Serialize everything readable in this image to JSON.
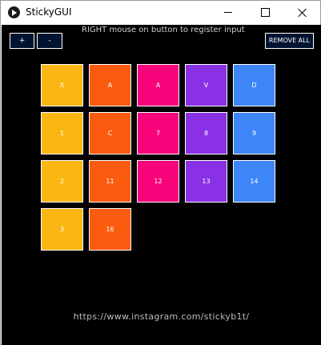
{
  "window": {
    "title": "StickyGUI",
    "icon": "play-icon",
    "controls": [
      "minimize-icon",
      "maximize-icon",
      "close-icon"
    ]
  },
  "toolbar": {
    "add_label": "+",
    "remove_label": "-",
    "remove_all_label": "REMOVE ALL",
    "hint": "RIGHT mouse on button to register input"
  },
  "colors": {
    "background": "#000000",
    "button_bg": "#001432",
    "yellow": "#fcb613",
    "orange": "#fb5b0f",
    "pink": "#f8047a",
    "purple": "#8a31e5",
    "blue": "#3d86f8"
  },
  "grid": {
    "rows": [
      [
        "X",
        "A",
        "A",
        "V",
        "D"
      ],
      [
        "1",
        "C",
        "7",
        "8",
        "9"
      ],
      [
        "2",
        "11",
        "12",
        "13",
        "14"
      ],
      [
        "3",
        "16"
      ]
    ]
  },
  "footer": {
    "link": "https://www.instagram.com/stickyb1t/"
  }
}
